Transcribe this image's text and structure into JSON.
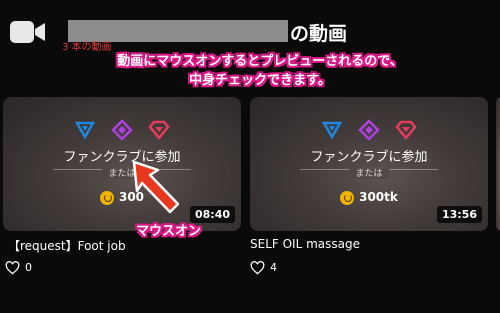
{
  "header": {
    "title_suffix": "の動画",
    "video_count": "3 本の動画"
  },
  "annotation": {
    "callout_line1": "動画にマウスオンするとプレビューされるので、",
    "callout_line2": "中身チェックできます。",
    "mouse_on_label": "マウスオン",
    "accent_color": "#e0198a"
  },
  "cards": [
    {
      "fanclub_label": "ファンクラブに参加",
      "or_label": "または",
      "price": "300",
      "duration": "08:40",
      "title": "【request】Foot job",
      "likes": "0"
    },
    {
      "fanclub_label": "ファンクラブに参加",
      "or_label": "または",
      "price": "300tk",
      "duration": "13:56",
      "title": "SELF OIL massage",
      "likes": "4"
    }
  ],
  "icons": [
    "camera-icon",
    "tier-blue-icon",
    "tier-purple-icon",
    "tier-red-icon",
    "coin-icon",
    "heart-icon",
    "cursor-arrow-icon"
  ]
}
